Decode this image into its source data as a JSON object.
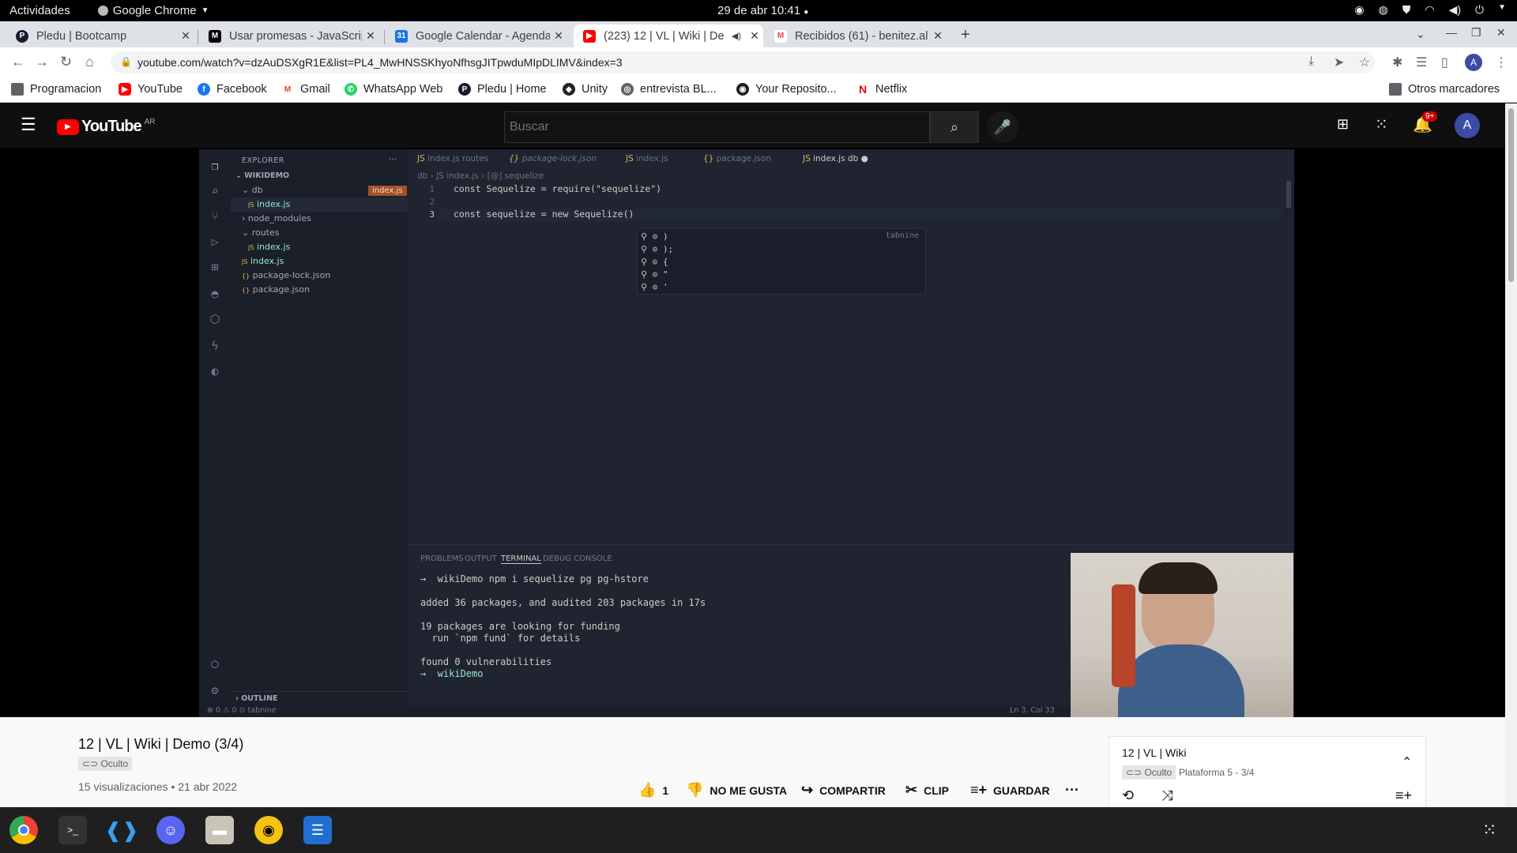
{
  "topbar": {
    "activities": "Actividades",
    "app": "Google Chrome",
    "datetime": "29 de abr  10:41"
  },
  "tabs": [
    {
      "title": "Pledu | Bootcamp"
    },
    {
      "title": "Usar promesas - JavaScrip"
    },
    {
      "title": "Google Calendar - Agenda"
    },
    {
      "title": "(223) 12 | VL | Wiki | De"
    },
    {
      "title": "Recibidos (61) - benitez.al"
    }
  ],
  "omnibox": {
    "url": "youtube.com/watch?v=dzAuDSXgR1E&list=PL4_MwHNSSKhyoNfhsgJITpwduMIpDLIMV&index=3"
  },
  "bookmarks": [
    {
      "label": "Programacion",
      "icon": "folder-icon",
      "color": "#5f6368"
    },
    {
      "label": "YouTube",
      "icon": "youtube-icon",
      "color": "#ff0000"
    },
    {
      "label": "Facebook",
      "icon": "facebook-icon",
      "color": "#1877f2"
    },
    {
      "label": "Gmail",
      "icon": "gmail-icon",
      "color": "#ea4335"
    },
    {
      "label": "WhatsApp Web",
      "icon": "whatsapp-icon",
      "color": "#25d366"
    },
    {
      "label": "Pledu | Home",
      "icon": "pledu-icon",
      "color": "#1a1a2e"
    },
    {
      "label": "Unity",
      "icon": "unity-icon",
      "color": "#222"
    },
    {
      "label": "entrevista BL...",
      "icon": "globe-icon",
      "color": "#5f6368"
    },
    {
      "label": "Your Reposito...",
      "icon": "github-icon",
      "color": "#202124"
    },
    {
      "label": "Netflix",
      "icon": "netflix-icon",
      "color": "#e50914"
    }
  ],
  "bookmarks_other": "Otros marcadores",
  "youtube": {
    "logo": "YouTube",
    "region": "AR",
    "search_placeholder": "Buscar",
    "notif_count": "9+",
    "avatar": "A"
  },
  "vscode": {
    "explorer_title": "EXPLORER",
    "project": "WIKIDEMO",
    "tree": [
      {
        "label": "db",
        "kind": "folder",
        "depth": 1
      },
      {
        "label": "index.js",
        "kind": "js",
        "depth": 2
      },
      {
        "label": "node_modules",
        "kind": "folder-closed",
        "depth": 1
      },
      {
        "label": "routes",
        "kind": "folder",
        "depth": 1
      },
      {
        "label": "index.js",
        "kind": "js",
        "depth": 2
      },
      {
        "label": "index.js",
        "kind": "js",
        "depth": 1
      },
      {
        "label": "package-lock.json",
        "kind": "json",
        "depth": 1
      },
      {
        "label": "package.json",
        "kind": "json",
        "depth": 1
      }
    ],
    "hover_label": "index.js",
    "outline": "OUTLINE",
    "tabs": [
      "index.js routes",
      "package-lock.json",
      "index.js",
      "package.json",
      "index.js db"
    ],
    "breadcrumb": "db  ›  JS index.js  ›  [@] sequelize",
    "code": [
      "const Sequelize = require(\"sequelize\")",
      "",
      "const sequelize = new Sequelize()"
    ],
    "suggest_source": "tabnine",
    "suggest_items": [
      ")",
      ");",
      "{",
      "\"",
      "'"
    ],
    "panel_tabs": [
      "PROBLEMS",
      "OUTPUT",
      "TERMINAL",
      "DEBUG CONSOLE"
    ],
    "terminal": [
      "→  wikiDemo npm i sequelize pg pg-hstore",
      "",
      "added 36 packages, and audited 203 packages in 17s",
      "",
      "19 packages are looking for funding",
      "  run `npm fund` for details",
      "",
      "found 0 vulnerabilities",
      "→  wikiDemo "
    ],
    "status_left": "⊗ 0 ⚠ 0     ⊙ tabnine",
    "status_right": "Ln 3, Col 33"
  },
  "video": {
    "title": "12 | VL | Wiki | Demo (3/4)",
    "visibility": "Oculto",
    "meta": "15 visualizaciones • 21 abr 2022",
    "likes": "1",
    "dislike": "NO ME GUSTA",
    "share": "COMPARTIR",
    "clip": "CLIP",
    "save": "GUARDAR"
  },
  "playlist": {
    "title": "12 | VL | Wiki",
    "visibility": "Oculto",
    "position": "Plataforma 5 - 3/4"
  }
}
